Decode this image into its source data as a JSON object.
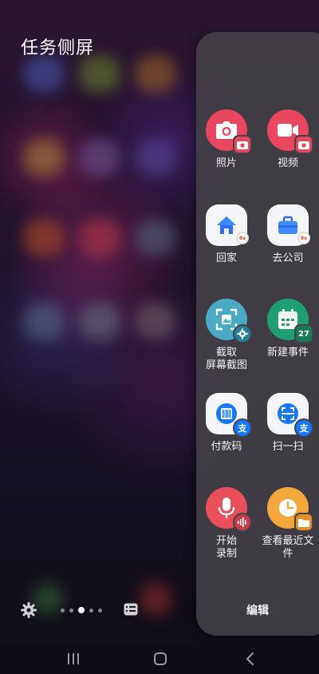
{
  "panel_title": "任务侧屏",
  "apps": [
    {
      "label": "照片"
    },
    {
      "label": "视频"
    },
    {
      "label": "回家"
    },
    {
      "label": "去公司"
    },
    {
      "label": "截取\n屏幕截图"
    },
    {
      "label": "新建事件"
    },
    {
      "label": "付款码"
    },
    {
      "label": "扫一扫"
    },
    {
      "label": "开始\n录制"
    },
    {
      "label": "查看最近文\n件"
    }
  ],
  "calendar_badge_day": "27",
  "map_badge_text": "8a",
  "edit_label": "编辑",
  "pager": {
    "count": 5,
    "active_index": 2
  },
  "colors": {
    "camera": "#e8475f",
    "screenshot": "#4aa9c5",
    "calendar": "#1f9e71",
    "alipay_blue": "#1677ff",
    "recorder": "#e8505a",
    "clock": "#f3a73b",
    "panel_bg": "#444248"
  }
}
